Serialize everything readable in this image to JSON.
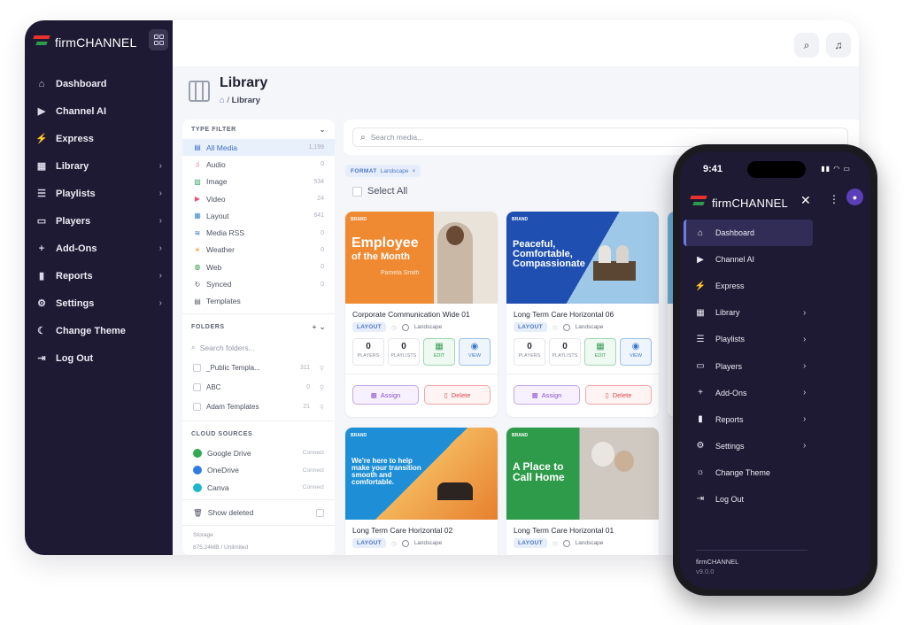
{
  "app": {
    "brand": "firmCHANNEL"
  },
  "sidebar": {
    "items": [
      {
        "label": "Dashboard",
        "icon": "home-icon",
        "glyph": "⌂",
        "chevron": false
      },
      {
        "label": "Channel AI",
        "icon": "play-icon",
        "glyph": "▶",
        "chevron": false
      },
      {
        "label": "Express",
        "icon": "bolt-icon",
        "glyph": "⚡",
        "chevron": false
      },
      {
        "label": "Library",
        "icon": "film-icon",
        "glyph": "▦",
        "chevron": true
      },
      {
        "label": "Playlists",
        "icon": "list-icon",
        "glyph": "☰",
        "chevron": true
      },
      {
        "label": "Players",
        "icon": "tv-icon",
        "glyph": "▭",
        "chevron": true
      },
      {
        "label": "Add-Ons",
        "icon": "plus-icon",
        "glyph": "+",
        "chevron": true
      },
      {
        "label": "Reports",
        "icon": "bar-chart-icon",
        "glyph": "▮",
        "chevron": true
      },
      {
        "label": "Settings",
        "icon": "gear-icon",
        "glyph": "⚙",
        "chevron": true
      },
      {
        "label": "Change Theme",
        "icon": "moon-icon",
        "glyph": "☾",
        "chevron": false
      },
      {
        "label": "Log Out",
        "icon": "logout-icon",
        "glyph": "⇥",
        "chevron": false
      }
    ]
  },
  "page": {
    "title": "Library",
    "breadcrumb_current": "Library",
    "breadcrumb_sep": "/"
  },
  "filter": {
    "type_header": "TYPE FILTER",
    "types": [
      {
        "label": "All Media",
        "count": "1,199",
        "glyph": "▤",
        "color": "#3d6fc4"
      },
      {
        "label": "Audio",
        "count": "0",
        "glyph": "♫",
        "color": "#e0567a"
      },
      {
        "label": "Image",
        "count": "534",
        "glyph": "▨",
        "color": "#39a86a"
      },
      {
        "label": "Video",
        "count": "24",
        "glyph": "▶",
        "color": "#e0567a"
      },
      {
        "label": "Layout",
        "count": "641",
        "glyph": "▦",
        "color": "#3d8fd0"
      },
      {
        "label": "Media RSS",
        "count": "0",
        "glyph": "≋",
        "color": "#3d6fc4"
      },
      {
        "label": "Weather",
        "count": "0",
        "glyph": "☀",
        "color": "#e5a21f"
      },
      {
        "label": "Web",
        "count": "0",
        "glyph": "◍",
        "color": "#2e9b4a"
      },
      {
        "label": "Synced",
        "count": "0",
        "glyph": "↻",
        "color": "#5b6070"
      },
      {
        "label": "Templates",
        "count": "",
        "glyph": "▤",
        "color": "#5b6070"
      }
    ],
    "folders_header": "FOLDERS",
    "folder_search_placeholder": "Search folders...",
    "folders": [
      {
        "label": "_Public Templa...",
        "count": "311"
      },
      {
        "label": "ABC",
        "count": "0"
      },
      {
        "label": "Adam Templates",
        "count": "21"
      }
    ],
    "cloud_header": "CLOUD SOURCES",
    "cloud": [
      {
        "label": "Google Drive",
        "action": "Connect",
        "color": "#34a853"
      },
      {
        "label": "OneDrive",
        "action": "Connect",
        "color": "#2f7de1"
      },
      {
        "label": "Canva",
        "action": "Connect",
        "color": "#1fb6c9"
      }
    ],
    "show_deleted": "Show deleted",
    "storage_label": "Storage",
    "storage_value": "875.24MB / Unlimited"
  },
  "media": {
    "search_placeholder": "Search media...",
    "format_tag_key": "FORMAT",
    "format_tag_value": "Landscape",
    "format_tag_close": "×",
    "select_all": "Select All",
    "cards": [
      {
        "title": "Corporate Communication Wide 01",
        "layout_tag": "LAYOUT",
        "orientation": "Landscape",
        "players": "0",
        "playlists": "0",
        "headline": "Employee",
        "headline2": "of the Month",
        "subline": "Pamela Smith",
        "brand": "BRAND",
        "bg": "#f08a32"
      },
      {
        "title": "Long Term Care Horizontal 06",
        "layout_tag": "LAYOUT",
        "orientation": "Landscape",
        "players": "0",
        "playlists": "0",
        "headline": "Peaceful, Comfortable, Compassionate",
        "headline2": "",
        "subline": "",
        "brand": "BRAND",
        "bg": "#1f4fb0"
      },
      {
        "title": "Long Term Care Horizontal 02",
        "layout_tag": "LAYOUT",
        "orientation": "Landscape",
        "headline": "We're here to help make your transition smooth and comfortable.",
        "brand": "BRAND",
        "bg": "#1e8fd6"
      },
      {
        "title": "Long Term Care Horizontal 01",
        "layout_tag": "LAYOUT",
        "orientation": "Landscape",
        "headline": "A Place to Call Home",
        "brand": "BRAND",
        "bg": "#2e9b4a"
      }
    ],
    "stat_labels": {
      "players": "PLAYERS",
      "playlists": "PLAYLISTS",
      "edit": "EDIT",
      "view": "VIEW"
    },
    "assign_label": "Assign",
    "delete_label": "Delete"
  },
  "phone": {
    "time": "9:41",
    "brand": "firmCHANNEL",
    "items": [
      {
        "label": "Dashboard",
        "icon": "home-icon",
        "glyph": "⌂",
        "chevron": false,
        "active": true
      },
      {
        "label": "Channel AI",
        "icon": "play-icon",
        "glyph": "▶",
        "chevron": false
      },
      {
        "label": "Express",
        "icon": "bolt-icon",
        "glyph": "⚡",
        "chevron": false
      },
      {
        "label": "Library",
        "icon": "film-icon",
        "glyph": "▦",
        "chevron": true
      },
      {
        "label": "Playlists",
        "icon": "list-icon",
        "glyph": "☰",
        "chevron": true
      },
      {
        "label": "Players",
        "icon": "tv-icon",
        "glyph": "▭",
        "chevron": true
      },
      {
        "label": "Add-Ons",
        "icon": "plus-icon",
        "glyph": "+",
        "chevron": true
      },
      {
        "label": "Reports",
        "icon": "bar-chart-icon",
        "glyph": "▮",
        "chevron": true
      },
      {
        "label": "Settings",
        "icon": "gear-icon",
        "glyph": "⚙",
        "chevron": true
      },
      {
        "label": "Change Theme",
        "icon": "sun-icon",
        "glyph": "☼",
        "chevron": false
      },
      {
        "label": "Log Out",
        "icon": "logout-icon",
        "glyph": "⇥",
        "chevron": false
      }
    ],
    "footer_brand": "firmCHANNEL",
    "version": "v9.0.0"
  }
}
